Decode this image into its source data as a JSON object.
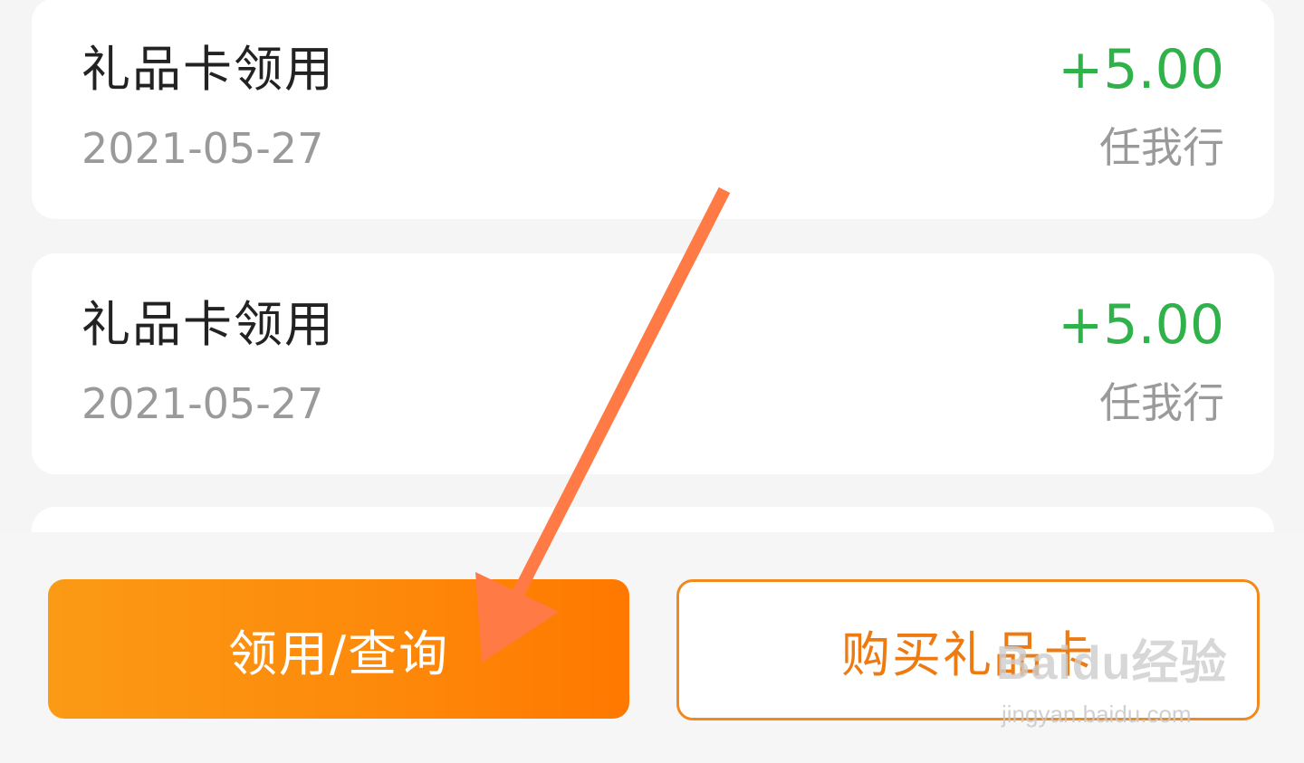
{
  "transactions": [
    {
      "title": "礼品卡领用",
      "date": "2021-05-27",
      "amount": "+5.00",
      "merchant": "任我行"
    },
    {
      "title": "礼品卡领用",
      "date": "2021-05-27",
      "amount": "+5.00",
      "merchant": "任我行"
    }
  ],
  "footer": {
    "primary_label": "领用/查询",
    "secondary_label": "购买礼品卡"
  },
  "watermark": {
    "brand": "Baidu经验",
    "url": "jingyan.baidu.com"
  },
  "colors": {
    "amount": "#2fb24a",
    "primary_start": "#fb9a15",
    "primary_end": "#ff7800",
    "secondary_border": "#f08a1e",
    "annotation_arrow": "#ff7a45"
  }
}
